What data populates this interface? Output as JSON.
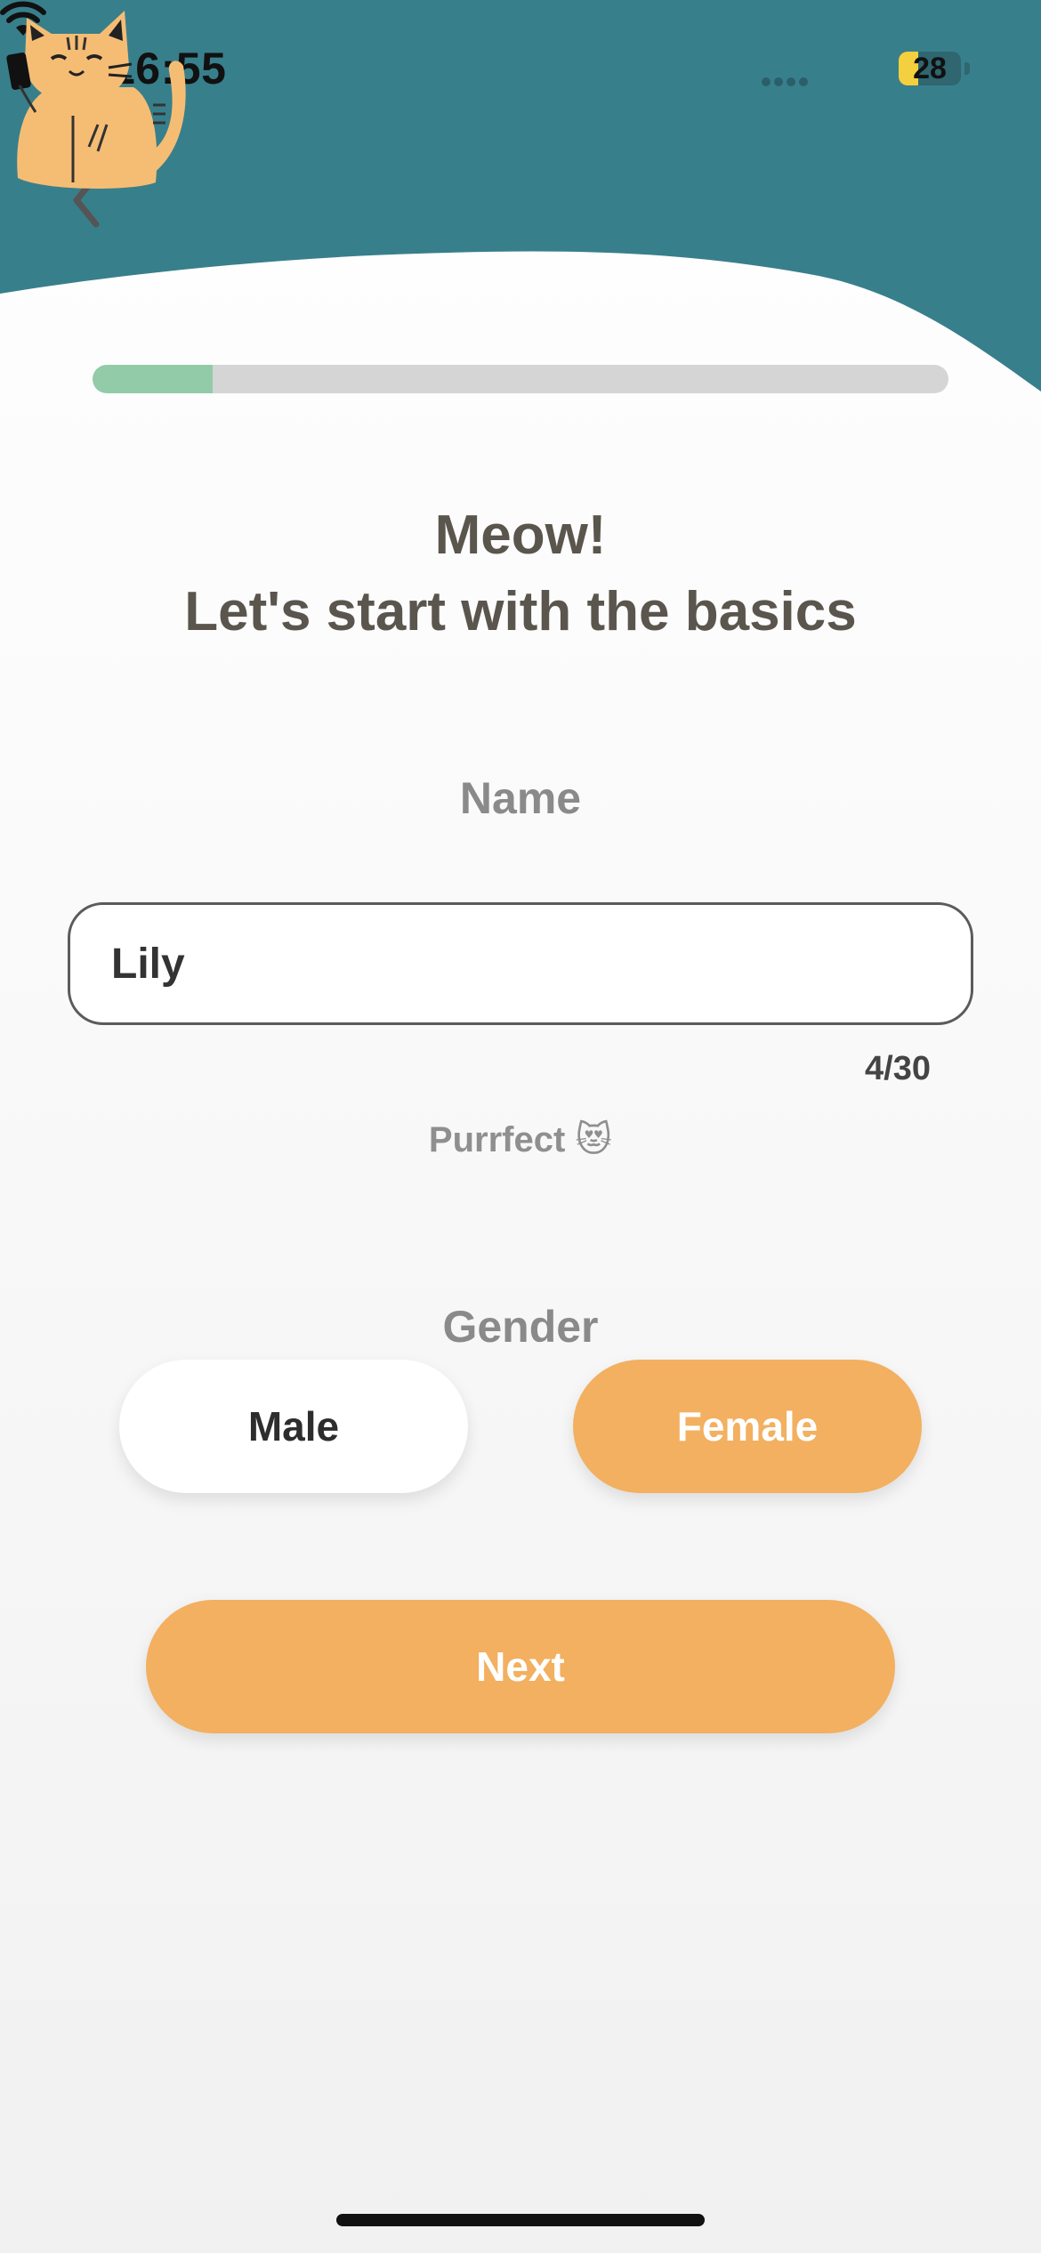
{
  "colors": {
    "header_teal": "#387f8c",
    "accent_orange": "#f2b060",
    "progress_green": "#92cba8",
    "title_text": "#5a554d"
  },
  "status_bar": {
    "time": "16:55",
    "battery": "28"
  },
  "nav": {
    "back_icon": "chevron-left-icon"
  },
  "progress": {
    "value_fraction": 0.14
  },
  "content": {
    "title_line1": "Meow!",
    "title_line2": "Let's start with the basics",
    "name_label": "Name",
    "name_value": "Lily",
    "char_counter": "4/30",
    "hint": "Purrfect 😻",
    "gender_label": "Gender",
    "gender_options": [
      "Male",
      "Female"
    ],
    "gender_selected": "Female",
    "next_label": "Next"
  }
}
